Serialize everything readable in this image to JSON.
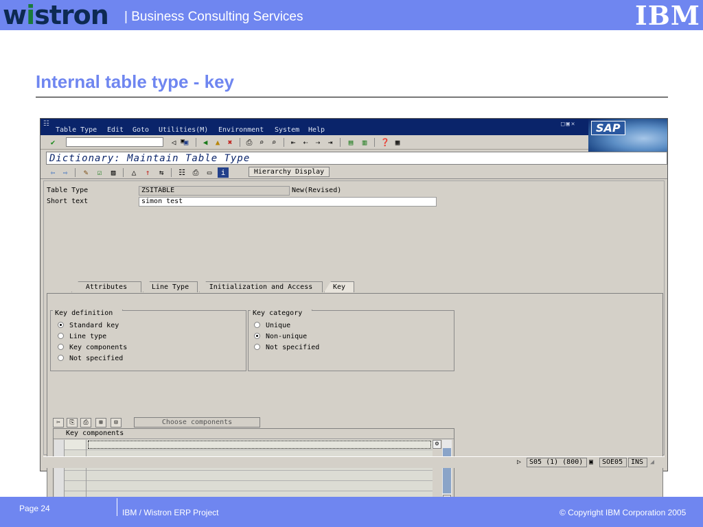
{
  "header": {
    "logo_text": "wistron",
    "subtitle": "| Business Consulting Services",
    "ibm_logo": "IBM"
  },
  "slide_title": "Internal table type - key",
  "sap": {
    "menu": [
      "Table Type",
      "Edit",
      "Goto",
      "Utilities(M)",
      "Environment",
      "System",
      "Help"
    ],
    "logo": "SAP",
    "title": "Dictionary: Maintain Table Type",
    "hierarchy_button": "Hierarchy Display",
    "fields": {
      "table_type_label": "Table Type",
      "table_type_value": "ZSITABLE",
      "table_type_status": "New(Revised)",
      "short_text_label": "Short text",
      "short_text_value": "simon test"
    },
    "tabs": [
      "Attributes",
      "Line Type",
      "Initialization and Access",
      "Key"
    ],
    "active_tab": "Key",
    "key_definition": {
      "title": "Key definition",
      "options": [
        "Standard key",
        "Line type",
        "Key components",
        "Not specified"
      ],
      "selected": "Standard key"
    },
    "key_category": {
      "title": "Key category",
      "options": [
        "Unique",
        "Non-unique",
        "Not specified"
      ],
      "selected": "Non-unique"
    },
    "choose_components": "Choose components",
    "grid_header": "Key components",
    "status": {
      "system": "S05 (1) (800)",
      "server": "SOE05",
      "mode": "INS"
    }
  },
  "footer": {
    "page": "Page 24",
    "project": "IBM / Wistron ERP Project",
    "copyright": "© Copyright IBM Corporation 2005"
  }
}
